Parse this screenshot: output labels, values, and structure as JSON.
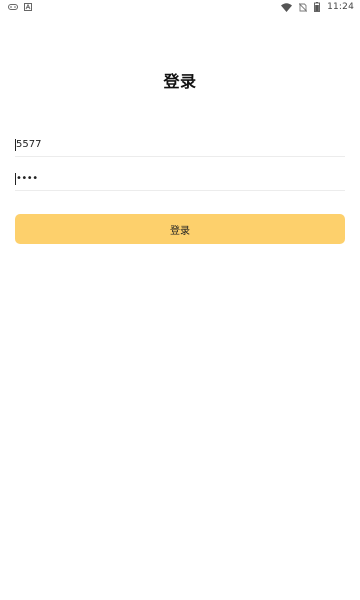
{
  "status_bar": {
    "time": "11:24",
    "left_icons": [
      "gamepad-icon",
      "text-a-icon"
    ],
    "right_icons": [
      "wifi-icon",
      "no-sim-icon",
      "battery-icon"
    ]
  },
  "login": {
    "title": "登录",
    "username_value": "5577",
    "password_value": "••••",
    "button_label": "登录"
  },
  "colors": {
    "background": "#ffffff",
    "button": "#fdd06c",
    "divider": "#ececec",
    "text": "#111111"
  }
}
